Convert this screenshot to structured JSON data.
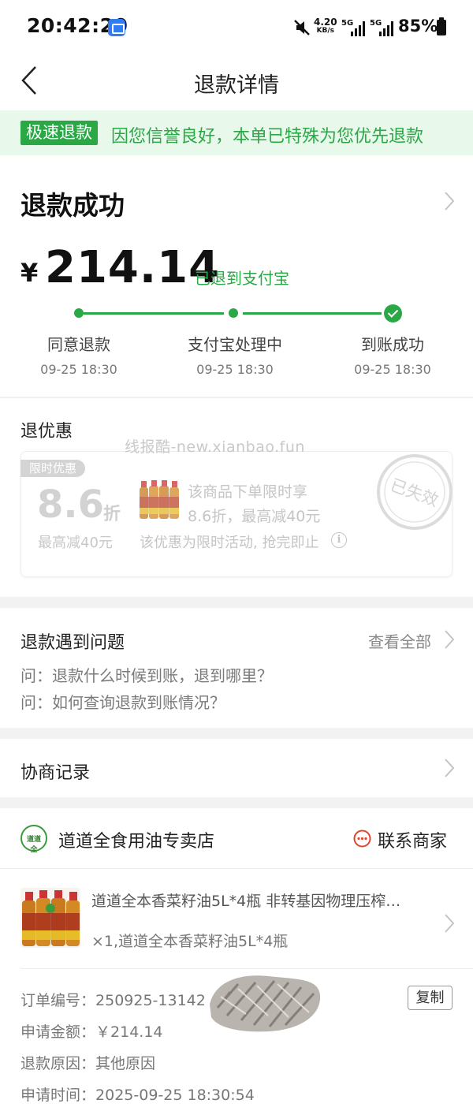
{
  "status_bar": {
    "time": "20:42:20",
    "net_speed_value": "4.20",
    "net_speed_unit": "KB/s",
    "sig1_label": "5G",
    "sig2_label": "5G",
    "battery": "85%"
  },
  "header": {
    "title": "退款详情"
  },
  "banner": {
    "tag": "极速退款",
    "text": "因您信誉良好，本单已特殊为您优先退款"
  },
  "refund": {
    "status": "退款成功",
    "currency": "¥",
    "amount": "214.14",
    "destination_note": "已退到支付宝",
    "steps": [
      {
        "label": "同意退款",
        "time": "09-25 18:30"
      },
      {
        "label": "支付宝处理中",
        "time": "09-25 18:30"
      },
      {
        "label": "到账成功",
        "time": "09-25 18:30"
      }
    ],
    "accent_color": "#2aa846"
  },
  "coupon": {
    "section_title": "退优惠",
    "watermark": "线报酷-new.xianbao.fun",
    "tag": "限时优惠",
    "discount": "8.6",
    "discount_unit": "折",
    "max_reduce": "最高减40元",
    "desc_line1": "该商品下单限时享",
    "desc_line2": "8.6折，最高减40元",
    "desc_line3": "该优惠为限时活动, 抢完即止",
    "stamp": "已失效"
  },
  "faq": {
    "title": "退款遇到问题",
    "see_all": "查看全部",
    "items": [
      "问：退款什么时候到账，退到哪里？",
      "问：如何查询退款到账情况？"
    ]
  },
  "negotiation": {
    "title": "协商记录"
  },
  "store": {
    "logo_text": "道道全",
    "name": "道道全食用油专卖店",
    "contact": "联系商家",
    "product_title": "道道全本香菜籽油5L*4瓶 非转基因物理压榨…",
    "product_spec": "×1,道道全本香菜籽油5L*4瓶",
    "order_no_label": "订单编号：",
    "order_no": "250925-13142",
    "copy": "复制",
    "apply_amount_label": "申请金额：",
    "apply_amount": "￥214.14",
    "reason_label": "退款原因：",
    "reason": "其他原因",
    "apply_time_label": "申请时间：",
    "apply_time": "2025-09-25 18:30:54"
  }
}
